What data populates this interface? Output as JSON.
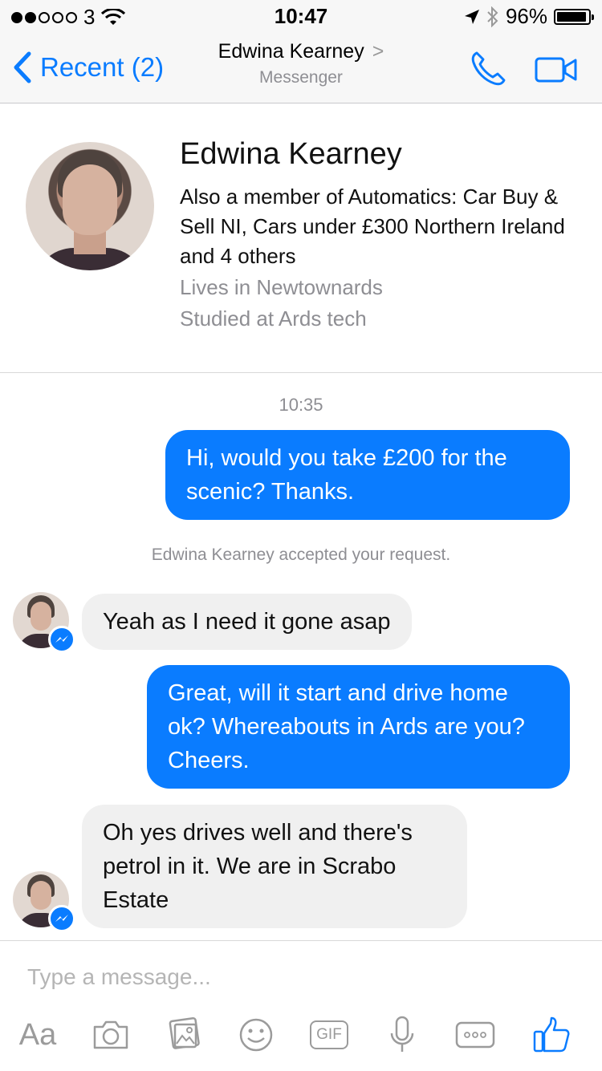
{
  "status_bar": {
    "carrier": "3",
    "time": "10:47",
    "battery": "96%"
  },
  "nav": {
    "back_label": "Recent (2)",
    "contact_name": "Edwina Kearney",
    "subtitle": "Messenger"
  },
  "profile": {
    "name": "Edwina Kearney",
    "groups": "Also a member of Automatics: Car Buy & Sell NI, Cars under £300 Northern Ireland and 4 others",
    "lives": "Lives in Newtownards",
    "studied": "Studied at Ards tech"
  },
  "chat": {
    "timestamp": "10:35",
    "system_note": "Edwina Kearney accepted your request.",
    "messages": [
      {
        "from": "me",
        "text": "Hi, would you take £200 for the scenic? Thanks."
      },
      {
        "from": "them",
        "text": "Yeah as  I need it gone asap"
      },
      {
        "from": "me",
        "text": "Great, will it start and drive home ok? Whereabouts in Ards are you? Cheers."
      },
      {
        "from": "them",
        "text": "Oh yes drives well and there's petrol in it. We are in Scrabo Estate"
      }
    ]
  },
  "composer": {
    "placeholder": "Type a message...",
    "text_label": "Aa",
    "gif_label": "GIF"
  },
  "colors": {
    "accent": "#0a7cff",
    "incoming_bubble": "#f0f0f0",
    "muted_text": "#8e8e93"
  }
}
